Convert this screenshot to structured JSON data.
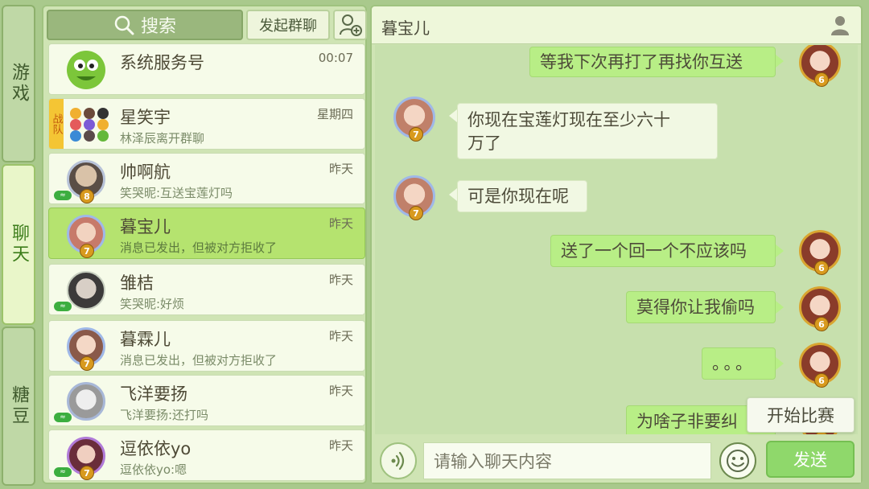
{
  "sidebar": {
    "tabs": [
      {
        "label": "游戏",
        "active": false
      },
      {
        "label": "聊天",
        "active": true
      },
      {
        "label": "糖豆",
        "active": false
      }
    ]
  },
  "toolbar": {
    "search_label": "搜索",
    "group_chat_label": "发起群聊",
    "add_friend_icon": "add-user-icon"
  },
  "conversations": [
    {
      "name": "系统服务号",
      "preview": "",
      "time": "00:07",
      "level": "",
      "online": false
    },
    {
      "name": "星笑宇",
      "preview": "林泽辰离开群聊",
      "time": "星期四",
      "team_tag": "战队"
    },
    {
      "name": "帅啊航",
      "preview": "笑哭昵:互送宝莲灯吗",
      "time": "昨天",
      "level": "8",
      "online": true
    },
    {
      "name": "暮宝儿",
      "preview": "消息已发出，但被对方拒收了",
      "time": "昨天",
      "level": "7",
      "online": false,
      "active": true
    },
    {
      "name": "雏桔",
      "preview": "笑哭昵:好烦",
      "time": "昨天",
      "level": "",
      "online": true
    },
    {
      "name": "暮霖儿",
      "preview": "消息已发出，但被对方拒收了",
      "time": "昨天",
      "level": "7",
      "online": false
    },
    {
      "name": "飞洋要扬",
      "preview": "飞洋要扬:还打吗",
      "time": "昨天",
      "level": "",
      "online": true
    },
    {
      "name": "逗依依yo",
      "preview": "逗依依yo:嗯",
      "time": "昨天",
      "level": "7",
      "online": true
    }
  ],
  "chat": {
    "title": "暮宝儿",
    "messages": [
      {
        "side": "right",
        "text": "等我下次再打了再找你互送",
        "level": "6"
      },
      {
        "side": "left",
        "text_line1": "你现在宝莲灯现在至少六十",
        "text_line2": "万了",
        "level": "7"
      },
      {
        "side": "left",
        "text": "可是你现在呢",
        "level": "7"
      },
      {
        "side": "right",
        "text": "送了一个回一个不应该吗",
        "level": "6"
      },
      {
        "side": "right",
        "text": "莫得你让我偷吗",
        "level": "6"
      },
      {
        "side": "right",
        "text": "。。。",
        "level": "6"
      },
      {
        "side": "right",
        "text": "为啥子非要纠",
        "level": "6"
      }
    ],
    "input_placeholder": "请输入聊天内容",
    "send_label": "发送",
    "match_label": "开始比赛"
  },
  "colors": {
    "accent_green": "#8fd86b",
    "bubble_self": "#b8ee86",
    "bubble_other": "#f1f8e3",
    "panel_bg": "#cfe4b4",
    "level_badge": "#d89a1e"
  }
}
